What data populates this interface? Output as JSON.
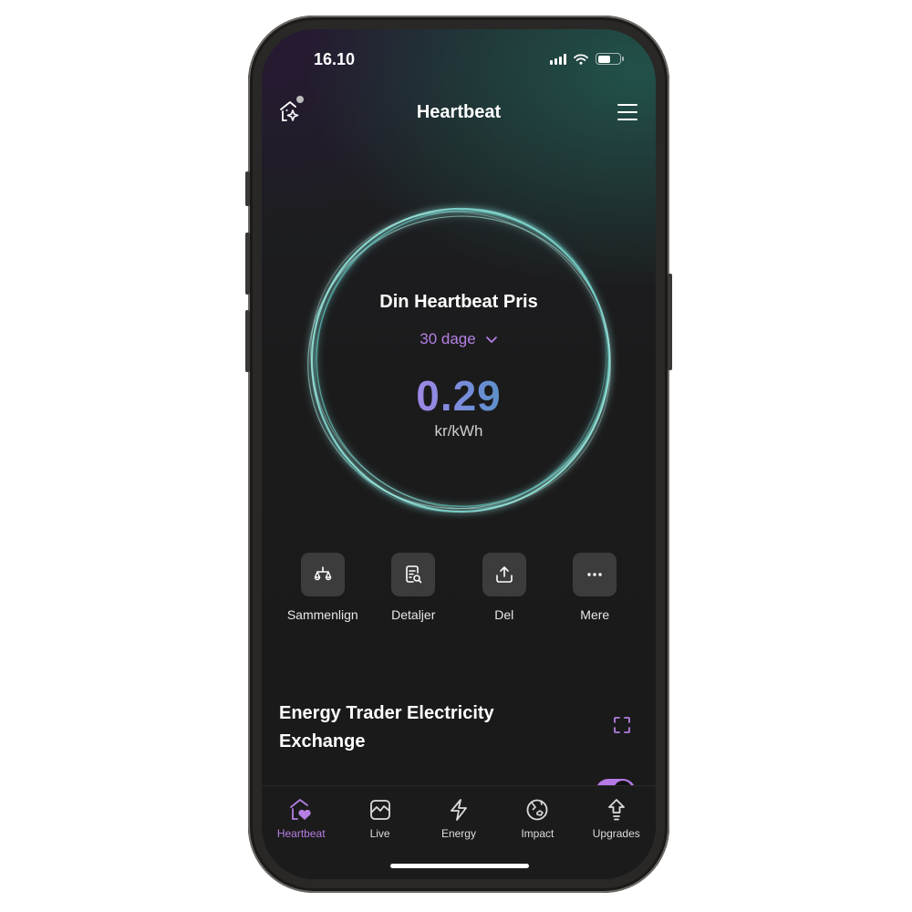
{
  "status_bar": {
    "time": "16.10",
    "battery_level": 0.6
  },
  "app_bar": {
    "title": "Heartbeat"
  },
  "price_card": {
    "label": "Din Heartbeat Pris",
    "period": "30 dage",
    "value": "0.29",
    "unit": "kr/kWh"
  },
  "actions": [
    {
      "label": "Sammenlign",
      "icon": "scale-icon"
    },
    {
      "label": "Detaljer",
      "icon": "document-search-icon"
    },
    {
      "label": "Del",
      "icon": "share-icon"
    },
    {
      "label": "Mere",
      "icon": "more-icon"
    }
  ],
  "section": {
    "title": "Energy Trader Electricity Exchange"
  },
  "tabs": [
    {
      "label": "Heartbeat",
      "icon": "home-heart-icon",
      "active": true
    },
    {
      "label": "Live",
      "icon": "chart-icon",
      "active": false
    },
    {
      "label": "Energy",
      "icon": "lightning-icon",
      "active": false
    },
    {
      "label": "Impact",
      "icon": "globe-icon",
      "active": false
    },
    {
      "label": "Upgrades",
      "icon": "upgrade-arrow-icon",
      "active": false
    }
  ],
  "colors": {
    "accent": "#b57fe3",
    "ring": "#7fd6cc",
    "background": "#1a1a1a"
  }
}
